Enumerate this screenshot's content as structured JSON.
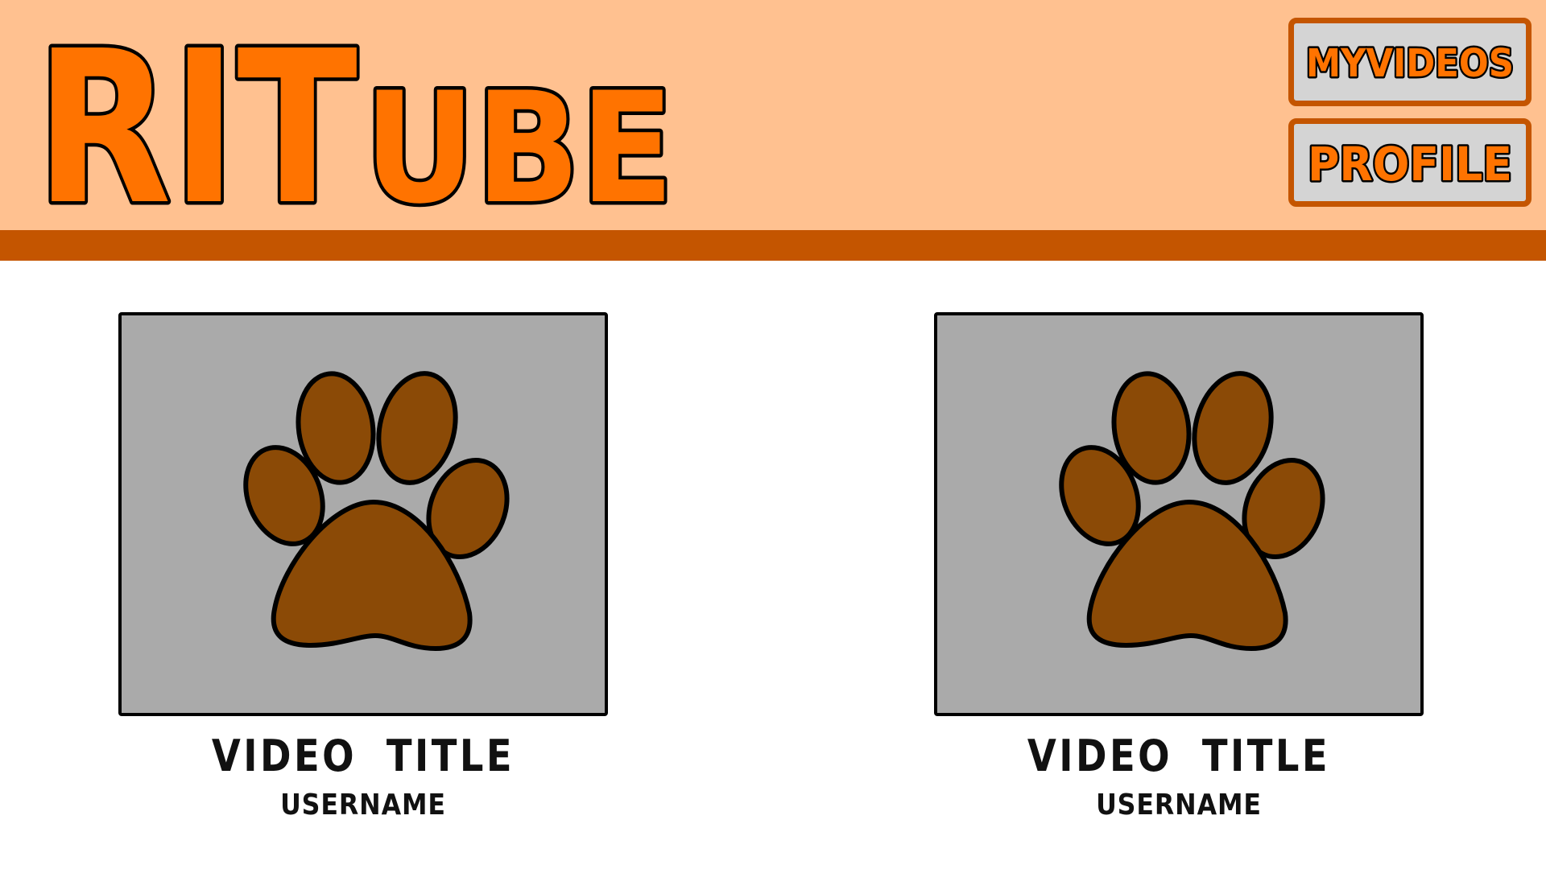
{
  "app": {
    "logo_text": "RITUBE",
    "logo_parts": {
      "first": "RIT",
      "second": "UBE"
    }
  },
  "nav": {
    "myvideos_label": "MYVIDEOS",
    "profile_label": "PROFILE"
  },
  "videos": [
    {
      "title": "VIDEO TITLE",
      "username": "USERNAME",
      "thumbnail_icon": "paw-print-icon"
    },
    {
      "title": "VIDEO TITLE",
      "username": "USERNAME",
      "thumbnail_icon": "paw-print-icon"
    }
  ],
  "colors": {
    "header_bg": "#ffc190",
    "header_stripe": "#c45500",
    "accent_orange": "#ff7300",
    "button_bg": "#d4d4d4",
    "thumbnail_bg": "#aaaaaa",
    "paw_fill": "#8b4a06"
  }
}
